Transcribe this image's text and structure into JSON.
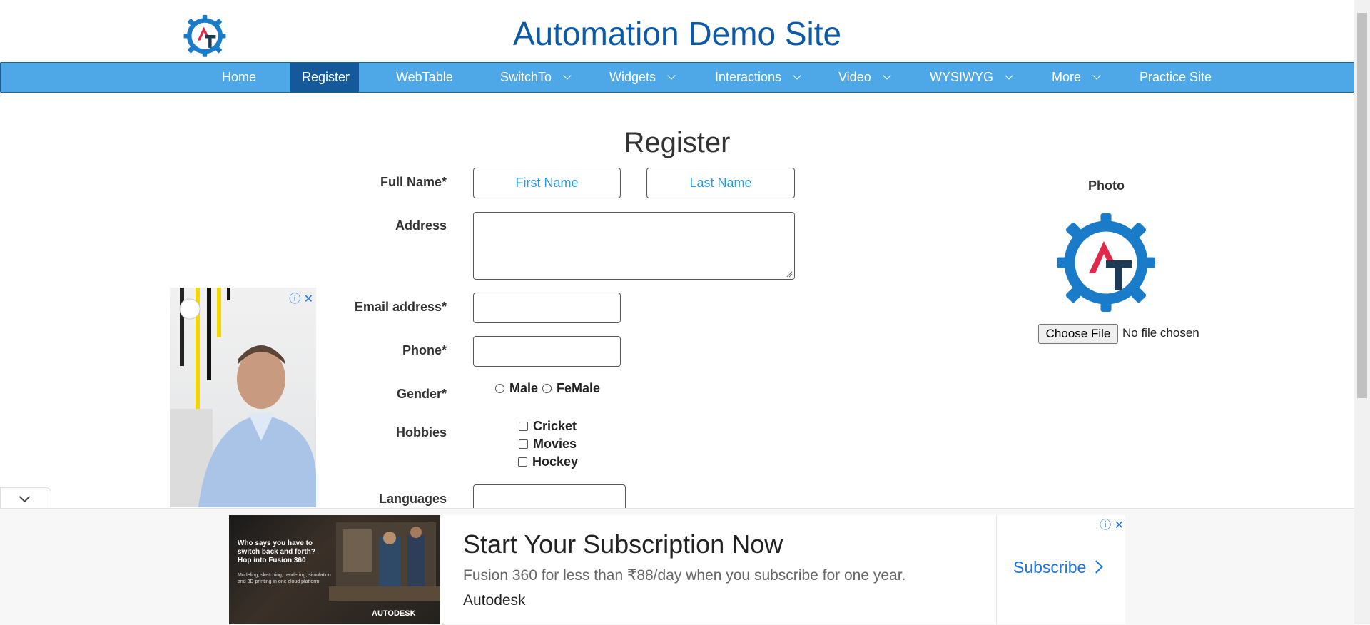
{
  "site": {
    "title": "Automation Demo Site",
    "logo_icon": "gear-at-logo-icon"
  },
  "nav": {
    "items": [
      {
        "label": "Home",
        "dropdown": false
      },
      {
        "label": "Register",
        "dropdown": false,
        "active": true
      },
      {
        "label": "WebTable",
        "dropdown": false
      },
      {
        "label": "SwitchTo",
        "dropdown": true
      },
      {
        "label": "Widgets",
        "dropdown": true
      },
      {
        "label": "Interactions",
        "dropdown": true
      },
      {
        "label": "Video",
        "dropdown": true
      },
      {
        "label": "WYSIWYG",
        "dropdown": true
      },
      {
        "label": "More",
        "dropdown": true
      },
      {
        "label": "Practice Site",
        "dropdown": false
      }
    ]
  },
  "form": {
    "heading": "Register",
    "full_name_label": "Full Name*",
    "first_name_placeholder": "First Name",
    "last_name_placeholder": "Last Name",
    "address_label": "Address",
    "email_label": "Email address*",
    "phone_label": "Phone*",
    "gender_label": "Gender*",
    "gender_options": [
      "Male",
      "FeMale"
    ],
    "hobbies_label": "Hobbies",
    "hobbies_options": [
      "Cricket",
      "Movies",
      "Hockey"
    ],
    "languages_label": "Languages"
  },
  "photo": {
    "label": "Photo",
    "choose_file": "Choose File",
    "file_status": "No file chosen"
  },
  "bottom_ad": {
    "image_headline": "Who says you have to switch back and forth? Hop into Fusion 360",
    "image_sub": "Modeling, sketching, rendering, simulation and 3D printing in one cloud platform",
    "image_brand": "AUTODESK",
    "headline": "Start Your Subscription Now",
    "description": "Fusion 360 for less than ₹88/day when you subscribe for one year.",
    "brand": "Autodesk",
    "cta": "Subscribe"
  },
  "colors": {
    "nav_bg": "#4ea8e8",
    "nav_active": "#14599a",
    "title": "#0c5aa6",
    "placeholder": "#2b9ad9",
    "logo_blue": "#1a7bc9",
    "logo_red": "#e0284a",
    "logo_dark": "#1d3b55"
  }
}
